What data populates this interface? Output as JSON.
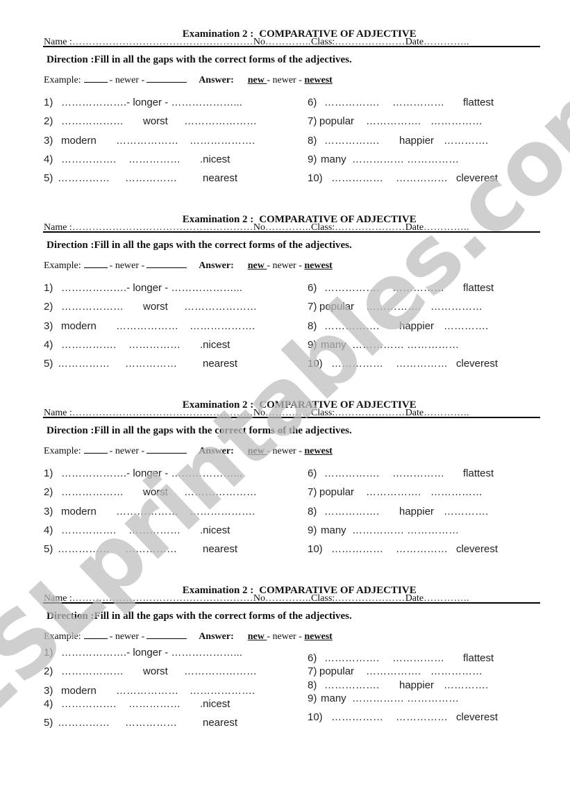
{
  "worksheet": {
    "sections": [
      {
        "title_part1": "Examination 2 :",
        "title_part2": "COMPARATIVE OF ADJECTIVE",
        "name_label": "Name :",
        "name_dots": "………………………………………………",
        "no_label": "No",
        "no_dots": "…………..",
        "class_label": "Class:",
        "class_dots": "…………………",
        "date_label": "Date",
        "date_dots": "…………..",
        "direction": "Direction :Fill in all the gaps with the correct forms of the adjectives.",
        "example": {
          "label": "Example:",
          "middle": "- newer -",
          "answer_label": "Answer:",
          "answer_new": "new ",
          "answer_middle": "- newer -",
          "answer_newest": "newest"
        },
        "items": [
          {
            "num": "1)",
            "parts": [
              "……………….- longer - ………………..."
            ],
            "cues": [
              "longer"
            ]
          },
          {
            "num": "2)",
            "parts": [
              "………………",
              "worst",
              "…………………"
            ]
          },
          {
            "num": "3)",
            "parts": [
              "modern",
              "………………",
              "………………."
            ]
          },
          {
            "num": "4)",
            "parts": [
              "…………….",
              "……………",
              ".nicest"
            ]
          },
          {
            "num": "5)",
            "parts": [
              "……………",
              "……………",
              "nearest"
            ]
          },
          {
            "num": "6)",
            "parts": [
              "…………….",
              "……………",
              "flattest"
            ]
          },
          {
            "num": "7)",
            "parts": [
              "popular",
              "…………….",
              "……………"
            ]
          },
          {
            "num": "8)",
            "parts": [
              "…………….",
              "happier",
              "…………."
            ]
          },
          {
            "num": "9)",
            "parts": [
              "many",
              "…………… ……………"
            ]
          },
          {
            "num": "10)",
            "parts": [
              "……………",
              "……………",
              "cleverest"
            ]
          }
        ]
      }
    ],
    "section_count": 4,
    "watermark": "ESLprintables.com"
  }
}
